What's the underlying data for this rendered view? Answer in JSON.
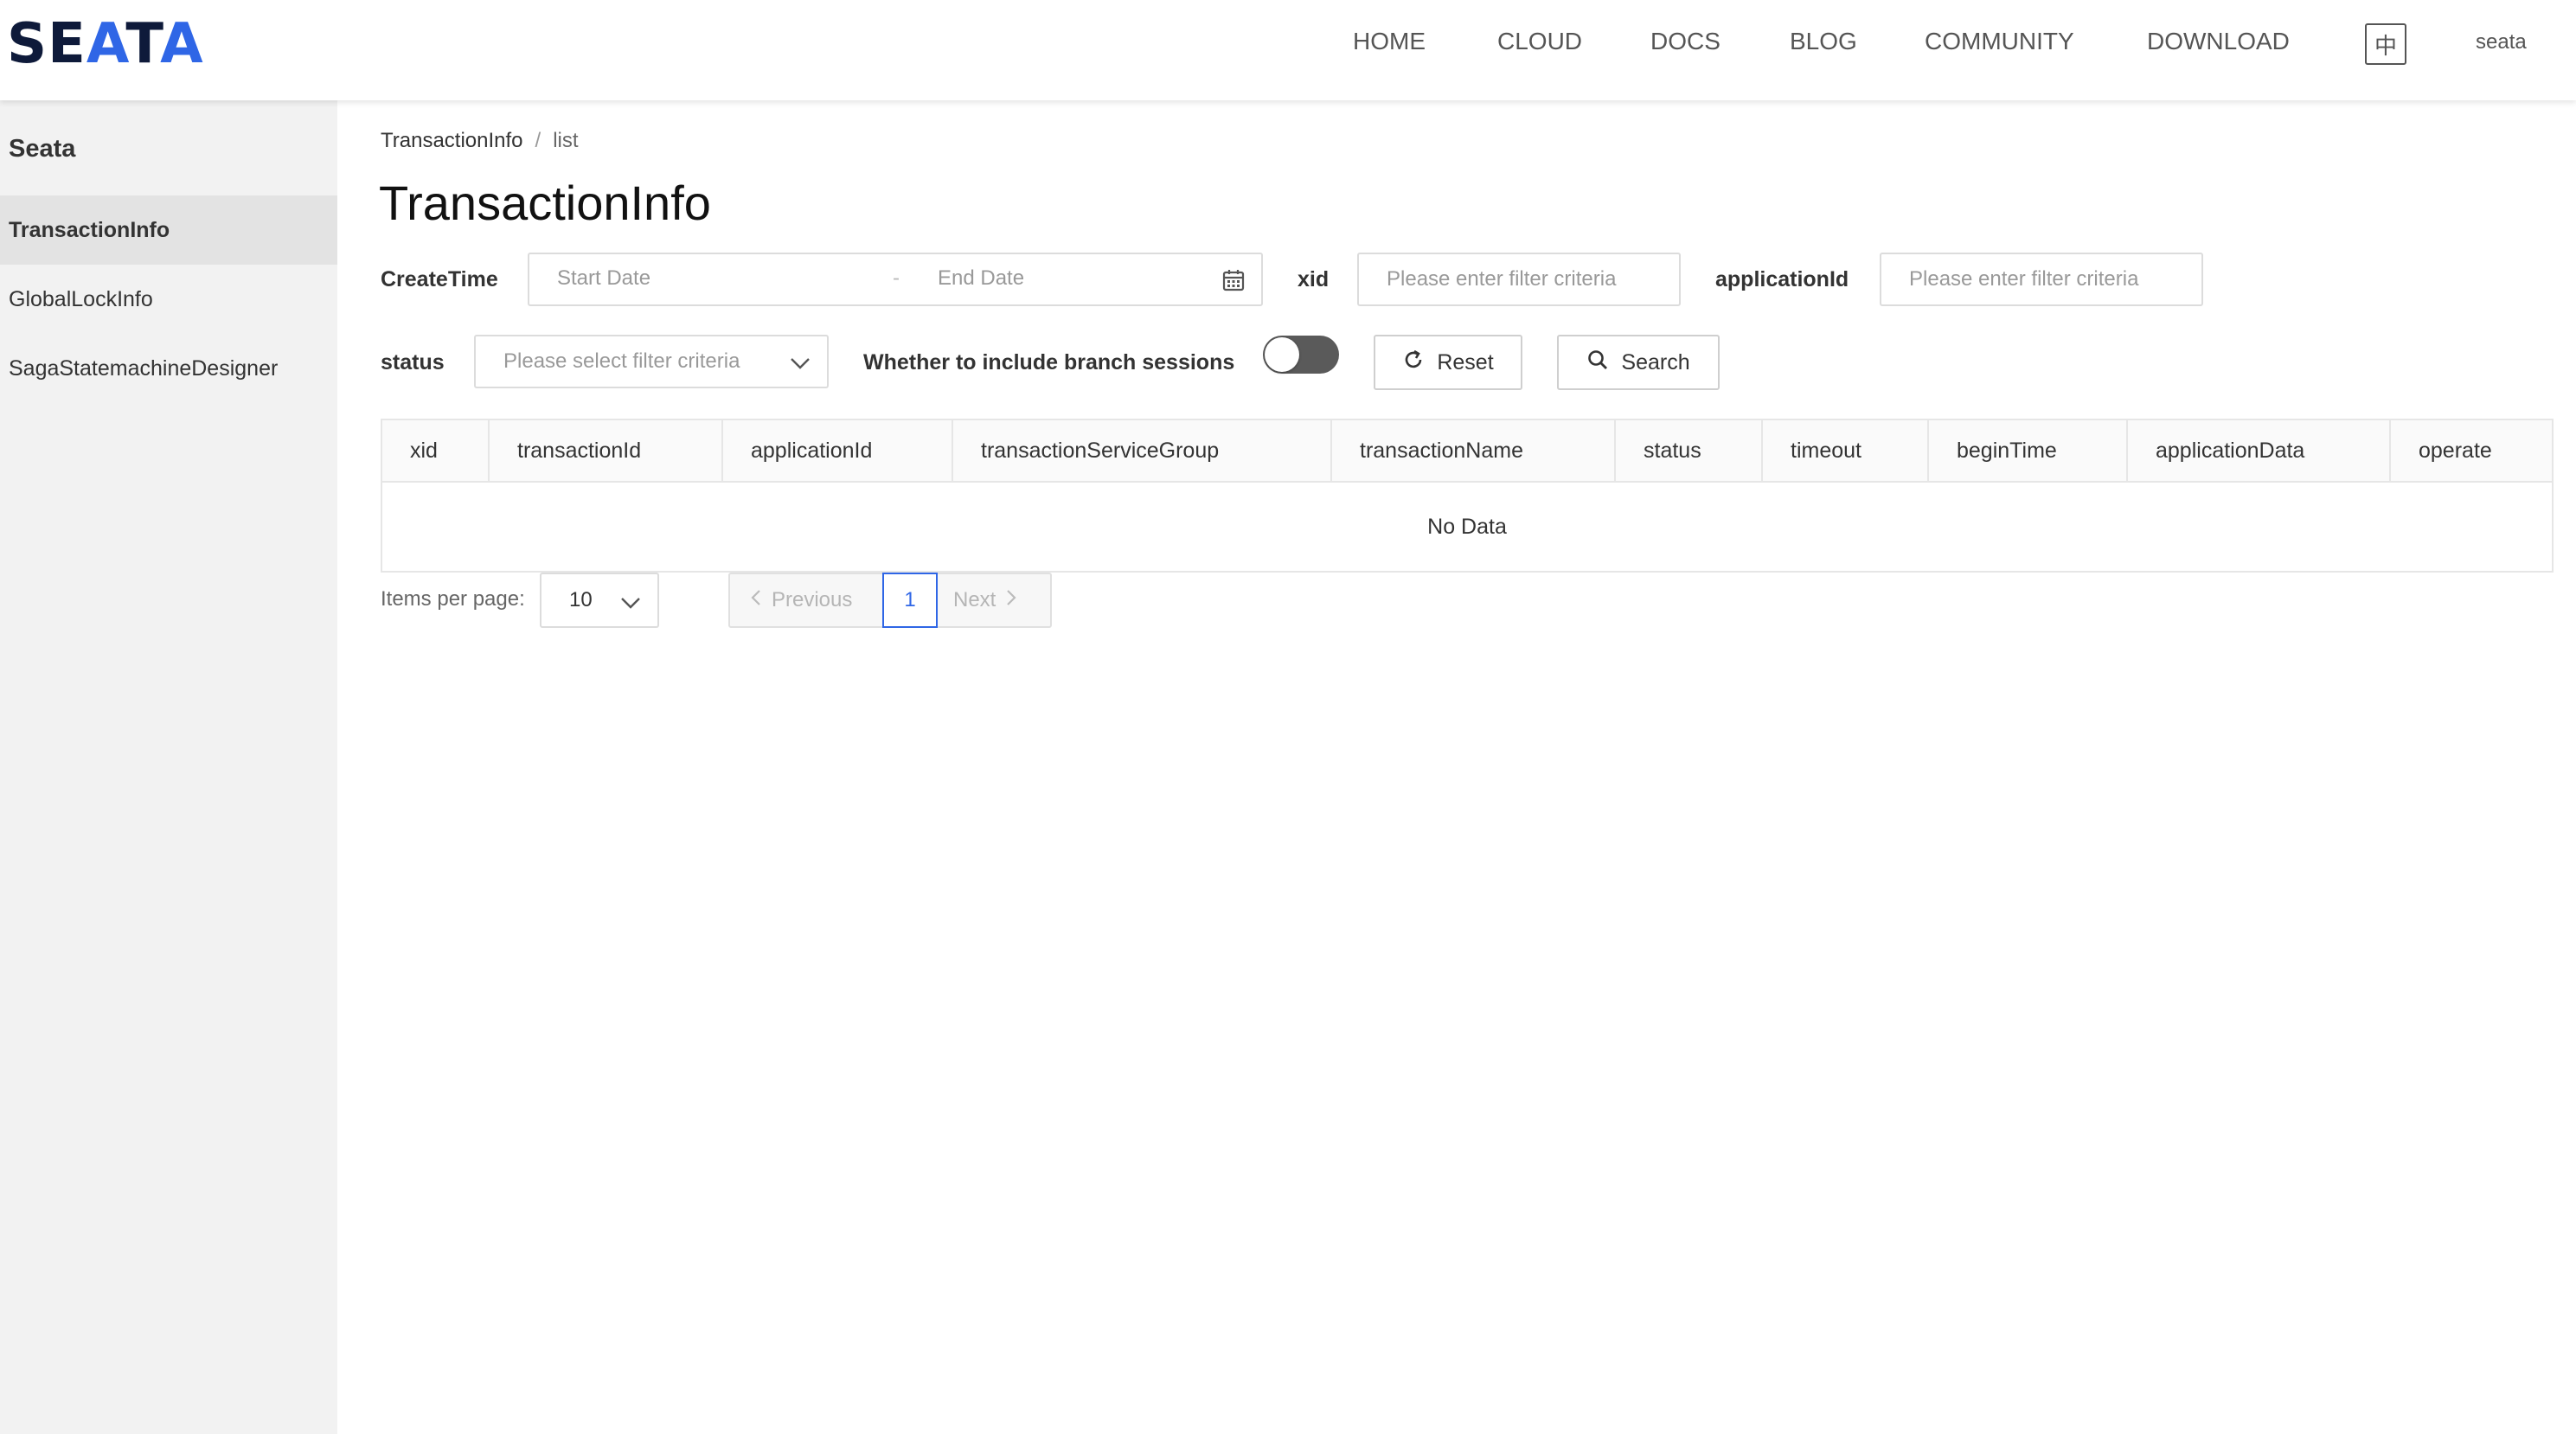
{
  "brand": {
    "logo_prefix": "SE",
    "logo_accent": "A",
    "logo_mid": "T",
    "logo_suffix": "A",
    "colors": {
      "dark": "#0e1a3a",
      "accent": "#2f66e6"
    }
  },
  "nav": {
    "items": [
      {
        "label": "HOME"
      },
      {
        "label": "CLOUD"
      },
      {
        "label": "DOCS"
      },
      {
        "label": "BLOG"
      },
      {
        "label": "COMMUNITY"
      },
      {
        "label": "DOWNLOAD"
      }
    ],
    "lang_button": "中",
    "user": "seata"
  },
  "sidebar": {
    "title": "Seata",
    "items": [
      {
        "label": "TransactionInfo",
        "active": true
      },
      {
        "label": "GlobalLockInfo",
        "active": false
      },
      {
        "label": "SagaStatemachineDesigner",
        "active": false
      }
    ]
  },
  "breadcrumb": {
    "root": "TransactionInfo",
    "separator": "/",
    "current": "list"
  },
  "page_title": "TransactionInfo",
  "filters": {
    "create_time": {
      "label": "CreateTime",
      "start_placeholder": "Start Date",
      "separator": "-",
      "end_placeholder": "End Date",
      "icon": "calendar-icon"
    },
    "xid": {
      "label": "xid",
      "placeholder": "Please enter filter criteria",
      "value": ""
    },
    "application_id": {
      "label": "applicationId",
      "placeholder": "Please enter filter criteria",
      "value": ""
    },
    "status": {
      "label": "status",
      "placeholder": "Please select filter criteria",
      "icon": "chevron-down-icon"
    },
    "branch_sessions": {
      "label": "Whether to include branch sessions",
      "on": false
    },
    "reset_button": {
      "label": "Reset",
      "icon": "refresh-icon"
    },
    "search_button": {
      "label": "Search",
      "icon": "search-icon"
    }
  },
  "table": {
    "columns": [
      "xid",
      "transactionId",
      "applicationId",
      "transactionServiceGroup",
      "transactionName",
      "status",
      "timeout",
      "beginTime",
      "applicationData",
      "operate"
    ],
    "rows": [],
    "empty_text": "No Data"
  },
  "pagination": {
    "items_per_page_label": "Items per page:",
    "page_size": "10",
    "previous_label": "Previous",
    "next_label": "Next",
    "current_page": "1"
  }
}
